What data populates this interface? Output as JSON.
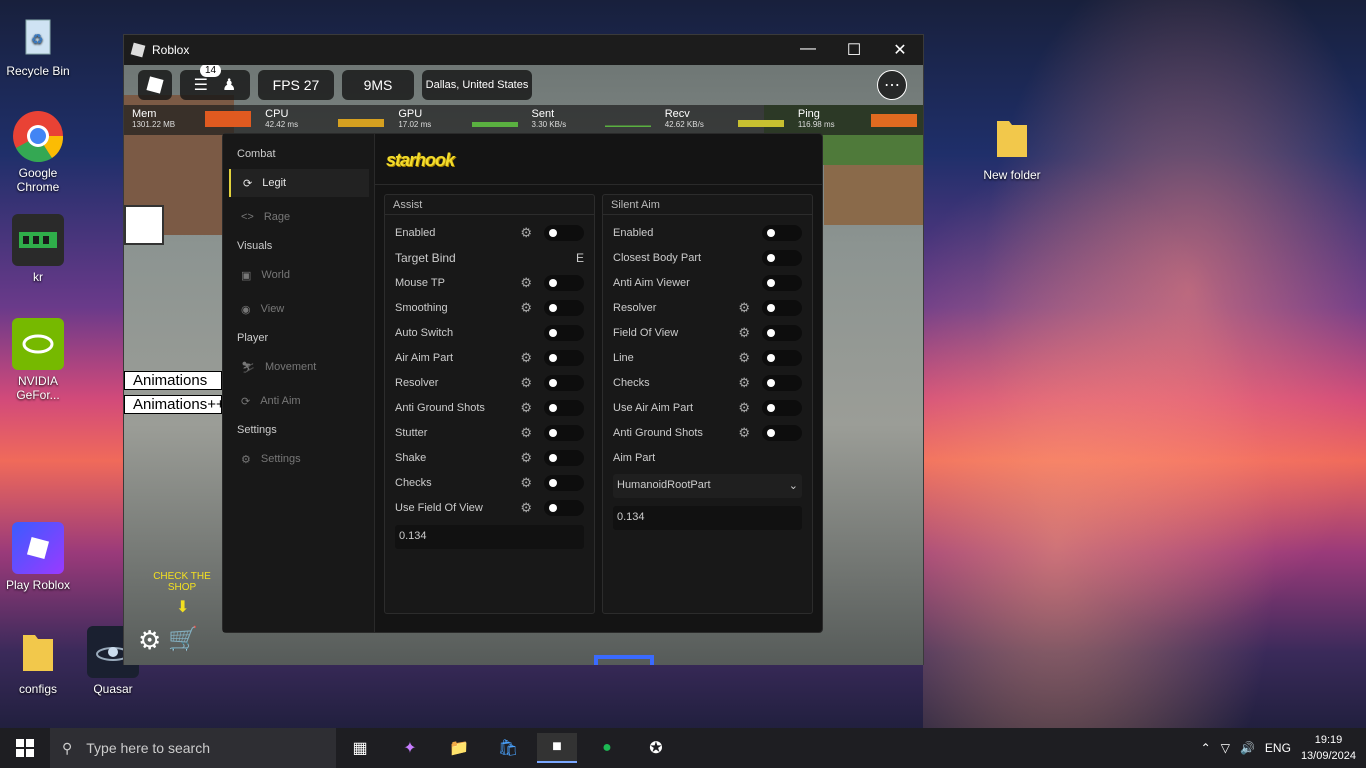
{
  "desktop": {
    "icons": [
      {
        "label": "Recycle Bin"
      },
      {
        "label": "Google Chrome"
      },
      {
        "label": "kr"
      },
      {
        "label": "NVIDIA GeFor..."
      },
      {
        "label": "Play Roblox"
      },
      {
        "label": "configs"
      },
      {
        "label": "Quasar"
      },
      {
        "label": "New folder"
      }
    ]
  },
  "window": {
    "title": "Roblox"
  },
  "hud": {
    "chat_badge": "14",
    "fps": "FPS 27",
    "ms": "9MS",
    "location": "Dallas, United States"
  },
  "stats": [
    {
      "label": "Mem",
      "value": "1301.22 MB",
      "color": "#e05a20"
    },
    {
      "label": "CPU",
      "value": "42.42 ms",
      "color": "#d6a020"
    },
    {
      "label": "GPU",
      "value": "17.02 ms",
      "color": "#5ab040"
    },
    {
      "label": "Sent",
      "value": "3.30 KB/s",
      "color": "#5ab040"
    },
    {
      "label": "Recv",
      "value": "42.62 KB/s",
      "color": "#c8c030"
    },
    {
      "label": "Ping",
      "value": "116.98 ms",
      "color": "#e06a20"
    }
  ],
  "game": {
    "anim1": "Animations",
    "anim2": "Animations++",
    "shop": "CHECK THE SHOP"
  },
  "menu": {
    "logo": "starhook",
    "sections": [
      "Combat",
      "Visuals",
      "Player",
      "Settings"
    ],
    "nav": [
      "Legit",
      "Rage",
      "World",
      "View",
      "Movement",
      "Anti Aim",
      "Settings"
    ],
    "assist": {
      "title": "Assist",
      "rows": [
        "Enabled",
        "Target Bind",
        "Mouse TP",
        "Smoothing",
        "Auto Switch",
        "Air Aim Part",
        "Resolver",
        "Anti Ground Shots",
        "Stutter",
        "Shake",
        "Checks",
        "Use Field Of View"
      ],
      "bind_key": "E",
      "slider": "0.134"
    },
    "silent": {
      "title": "Silent Aim",
      "rows": [
        "Enabled",
        "Closest Body Part",
        "Anti Aim Viewer",
        "Resolver",
        "Field Of View",
        "Line",
        "Checks",
        "Use Air Aim Part",
        "Anti Ground Shots",
        "Aim Part"
      ],
      "dropdown": "HumanoidRootPart",
      "slider": "0.134"
    }
  },
  "taskbar": {
    "search_placeholder": "Type here to search",
    "lang": "ENG",
    "time": "19:19",
    "date": "13/09/2024"
  }
}
